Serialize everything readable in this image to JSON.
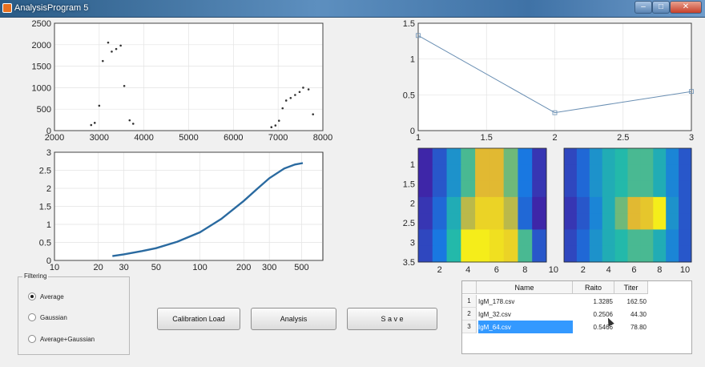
{
  "window": {
    "title": "AnalysisProgram 5"
  },
  "colors": {
    "series": "#2a6aa0",
    "accent_selection": "#3399ff",
    "line_marker": "#6a8fb3"
  },
  "charts": {
    "scatter": {
      "type": "scatter",
      "xlim": [
        2000,
        8000
      ],
      "ylim": [
        0,
        2500
      ],
      "x_ticks": [
        "2000",
        "3000",
        "4000",
        "5000",
        "6000",
        "7000",
        "8000"
      ],
      "y_ticks": [
        "0",
        "500",
        "1000",
        "1500",
        "2000",
        "2500"
      ],
      "points": [
        [
          2820,
          130
        ],
        [
          2900,
          180
        ],
        [
          3000,
          580
        ],
        [
          3080,
          1620
        ],
        [
          3200,
          2050
        ],
        [
          3280,
          1840
        ],
        [
          3380,
          1900
        ],
        [
          3480,
          1980
        ],
        [
          3560,
          1040
        ],
        [
          3680,
          240
        ],
        [
          3760,
          160
        ],
        [
          6850,
          80
        ],
        [
          6940,
          120
        ],
        [
          7020,
          230
        ],
        [
          7100,
          520
        ],
        [
          7180,
          700
        ],
        [
          7280,
          760
        ],
        [
          7380,
          830
        ],
        [
          7480,
          900
        ],
        [
          7560,
          1000
        ],
        [
          7680,
          960
        ],
        [
          7780,
          380
        ]
      ]
    },
    "curve": {
      "type": "line",
      "xscale": "log",
      "xlim": [
        10,
        700
      ],
      "ylim": [
        0,
        3
      ],
      "x_ticks": [
        "10",
        "20",
        "30",
        "50",
        "100",
        "200",
        "300",
        "500"
      ],
      "y_ticks": [
        "0",
        "0.5",
        "1",
        "1.5",
        "2",
        "2.5",
        "3"
      ],
      "points": [
        [
          25,
          0.12
        ],
        [
          30,
          0.17
        ],
        [
          40,
          0.26
        ],
        [
          50,
          0.34
        ],
        [
          70,
          0.52
        ],
        [
          100,
          0.78
        ],
        [
          140,
          1.15
        ],
        [
          200,
          1.65
        ],
        [
          250,
          2.0
        ],
        [
          300,
          2.28
        ],
        [
          380,
          2.55
        ],
        [
          450,
          2.66
        ],
        [
          510,
          2.7
        ]
      ]
    },
    "ratio_line": {
      "type": "line",
      "xlim": [
        1,
        3
      ],
      "ylim": [
        0,
        1.5
      ],
      "x_ticks": [
        "1",
        "1.5",
        "2",
        "2.5",
        "3"
      ],
      "y_ticks": [
        "0",
        "0.5",
        "1",
        "1.5"
      ],
      "x": [
        1,
        2,
        3
      ],
      "y": [
        1.3285,
        0.2506,
        0.5466
      ]
    },
    "heatmap_left": {
      "type": "heatmap",
      "y_ticks": [
        "1",
        "1.5",
        "2",
        "2.5",
        "3",
        "3.5"
      ],
      "x_ticks": [
        "2",
        "4",
        "6",
        "8",
        "10"
      ],
      "values": [
        [
          0.0,
          0.15,
          0.35,
          0.55,
          0.75,
          0.75,
          0.6,
          0.25,
          0.05
        ],
        [
          0.0,
          0.15,
          0.35,
          0.55,
          0.75,
          0.75,
          0.6,
          0.25,
          0.05
        ],
        [
          0.0,
          0.15,
          0.35,
          0.55,
          0.75,
          0.75,
          0.6,
          0.25,
          0.05
        ],
        [
          0.05,
          0.2,
          0.45,
          0.7,
          0.85,
          0.85,
          0.7,
          0.2,
          0.0
        ],
        [
          0.05,
          0.2,
          0.45,
          0.7,
          0.85,
          0.85,
          0.7,
          0.2,
          0.0
        ],
        [
          0.1,
          0.25,
          0.5,
          0.95,
          0.95,
          0.9,
          0.85,
          0.55,
          0.15
        ],
        [
          0.1,
          0.25,
          0.5,
          0.95,
          0.95,
          0.9,
          0.85,
          0.55,
          0.15
        ]
      ]
    },
    "heatmap_right": {
      "type": "heatmap",
      "y_ticks": [],
      "x_ticks": [
        "2",
        "4",
        "6",
        "8",
        "10"
      ],
      "values": [
        [
          0.1,
          0.2,
          0.35,
          0.45,
          0.5,
          0.55,
          0.55,
          0.45,
          0.3,
          0.15
        ],
        [
          0.1,
          0.2,
          0.35,
          0.45,
          0.5,
          0.55,
          0.55,
          0.45,
          0.3,
          0.15
        ],
        [
          0.1,
          0.2,
          0.35,
          0.45,
          0.5,
          0.55,
          0.55,
          0.45,
          0.3,
          0.15
        ],
        [
          0.05,
          0.15,
          0.3,
          0.45,
          0.6,
          0.75,
          0.8,
          0.95,
          0.35,
          0.15
        ],
        [
          0.05,
          0.15,
          0.3,
          0.45,
          0.6,
          0.75,
          0.8,
          0.95,
          0.35,
          0.15
        ],
        [
          0.1,
          0.2,
          0.35,
          0.45,
          0.5,
          0.55,
          0.55,
          0.45,
          0.3,
          0.15
        ],
        [
          0.1,
          0.2,
          0.35,
          0.45,
          0.5,
          0.55,
          0.55,
          0.45,
          0.3,
          0.15
        ]
      ]
    }
  },
  "filtering": {
    "legend": "Filtering",
    "options": [
      {
        "label": "Average",
        "checked": true
      },
      {
        "label": "Gaussian",
        "checked": false
      },
      {
        "label": "Average+Gaussian",
        "checked": false
      }
    ]
  },
  "buttons": {
    "calibration": "Calibration Load",
    "analysis": "Analysis",
    "save": "S a v e"
  },
  "table": {
    "headers": [
      "Name",
      "Raito",
      "Titer"
    ],
    "rows": [
      {
        "num": "1",
        "name": "IgM_178.csv",
        "ratio": "1.3285",
        "titer": "162.50",
        "selected": false
      },
      {
        "num": "2",
        "name": "IgM_32.csv",
        "ratio": "0.2506",
        "titer": "44.30",
        "selected": false
      },
      {
        "num": "3",
        "name": "IgM_64.csv",
        "ratio": "0.5466",
        "titer": "78.80",
        "selected": true
      }
    ]
  }
}
